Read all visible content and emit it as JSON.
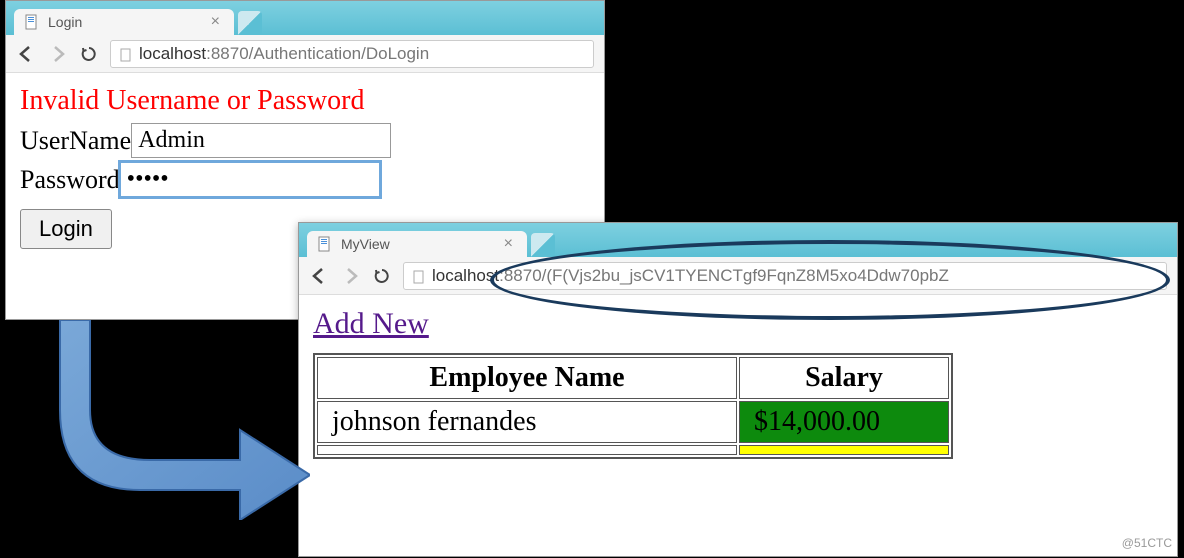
{
  "window1": {
    "tab_title": "Login",
    "url_prefix": "localhost",
    "url_path": ":8870/Authentication/DoLogin",
    "error": "Invalid Username or Password",
    "username_label": "UserName",
    "username_value": "Admin",
    "password_label": "Password",
    "password_value": "•••••",
    "login_button": "Login"
  },
  "window2": {
    "tab_title": "MyView",
    "url_prefix": "localhost",
    "url_path": ":8870/(F(Vjs2bu_jsCV1TYENCTgf9FqnZ8M5xo4Ddw70pbZ",
    "add_new": "Add New",
    "table": {
      "headers": [
        "Employee Name",
        "Salary"
      ],
      "rows": [
        {
          "name": "johnson fernandes",
          "salary": "$14,000.00",
          "color": "green"
        },
        {
          "name": "",
          "salary": "",
          "color": "yellow"
        }
      ]
    }
  },
  "watermark": "@51CTC"
}
